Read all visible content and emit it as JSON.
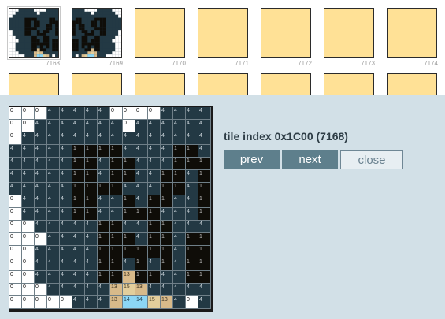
{
  "tile_strip": {
    "row1": [
      {
        "number": "7168",
        "kind": "pixel",
        "selected": true
      },
      {
        "number": "7169",
        "kind": "pixel",
        "selected": false
      },
      {
        "number": "7170",
        "kind": "blank",
        "selected": false
      },
      {
        "number": "7171",
        "kind": "blank",
        "selected": false
      },
      {
        "number": "7172",
        "kind": "blank",
        "selected": false
      },
      {
        "number": "7173",
        "kind": "blank",
        "selected": false
      },
      {
        "number": "7174",
        "kind": "blank",
        "selected": false
      }
    ],
    "row2_count": 7
  },
  "editor": {
    "tile_index_text": "tile index 0x1C00 (7168)",
    "buttons": {
      "prev": "prev",
      "next": "next",
      "close": "close"
    },
    "palette": {
      "0": "#ffffff",
      "1": "#0f0d08",
      "4": "#233944",
      "13": "#d8ba8a",
      "14": "#8cd6f5",
      "15": "#e3ce9c"
    },
    "grid": [
      [
        0,
        0,
        0,
        4,
        4,
        4,
        4,
        4,
        0,
        0,
        0,
        0,
        4,
        4,
        4,
        4
      ],
      [
        0,
        0,
        4,
        4,
        4,
        4,
        4,
        4,
        4,
        0,
        4,
        4,
        4,
        4,
        4,
        4
      ],
      [
        0,
        4,
        4,
        4,
        4,
        4,
        4,
        4,
        4,
        4,
        4,
        4,
        4,
        4,
        4,
        4
      ],
      [
        4,
        4,
        4,
        4,
        4,
        1,
        1,
        1,
        1,
        4,
        4,
        4,
        4,
        1,
        1,
        4
      ],
      [
        4,
        4,
        4,
        4,
        4,
        1,
        1,
        4,
        1,
        1,
        4,
        4,
        4,
        1,
        1,
        1
      ],
      [
        4,
        4,
        4,
        4,
        4,
        1,
        1,
        4,
        1,
        1,
        4,
        4,
        1,
        1,
        4,
        1
      ],
      [
        4,
        4,
        4,
        4,
        4,
        1,
        1,
        1,
        1,
        4,
        4,
        4,
        1,
        1,
        4,
        1
      ],
      [
        0,
        4,
        4,
        4,
        4,
        1,
        1,
        4,
        4,
        1,
        4,
        1,
        1,
        4,
        4,
        1
      ],
      [
        0,
        4,
        4,
        4,
        4,
        1,
        1,
        4,
        4,
        1,
        1,
        1,
        4,
        4,
        4,
        1
      ],
      [
        0,
        0,
        4,
        4,
        4,
        4,
        4,
        1,
        1,
        4,
        4,
        1,
        1,
        4,
        4,
        4
      ],
      [
        0,
        0,
        0,
        4,
        4,
        4,
        4,
        1,
        1,
        1,
        4,
        1,
        1,
        4,
        1,
        1
      ],
      [
        0,
        0,
        4,
        4,
        4,
        4,
        4,
        1,
        1,
        1,
        1,
        1,
        1,
        4,
        1,
        1
      ],
      [
        0,
        0,
        4,
        4,
        4,
        4,
        4,
        1,
        1,
        4,
        1,
        4,
        1,
        4,
        1,
        1
      ],
      [
        0,
        0,
        4,
        4,
        4,
        4,
        4,
        1,
        1,
        13,
        1,
        1,
        4,
        4,
        1,
        1
      ],
      [
        0,
        0,
        0,
        4,
        4,
        4,
        4,
        4,
        13,
        15,
        13,
        4,
        4,
        4,
        4,
        4
      ],
      [
        0,
        0,
        0,
        0,
        0,
        4,
        4,
        4,
        13,
        14,
        14,
        15,
        13,
        4,
        0,
        4
      ]
    ]
  }
}
